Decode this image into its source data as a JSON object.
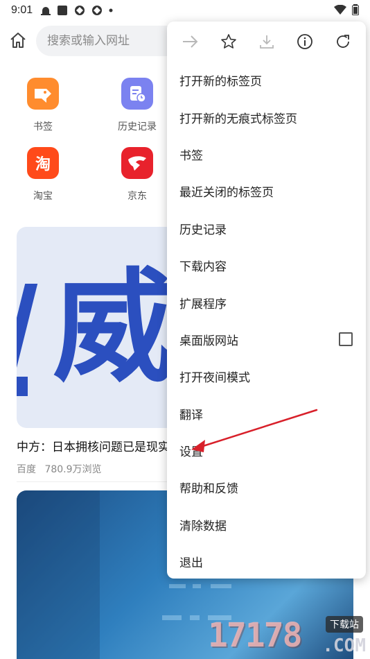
{
  "status_bar": {
    "time": "9:01",
    "icons": [
      "notification-icon",
      "square-icon",
      "network-icon",
      "network-icon",
      "dot-icon"
    ],
    "right_icons": [
      "wifi-icon",
      "battery-icon"
    ]
  },
  "search": {
    "placeholder": "搜索或输入网址"
  },
  "shortcuts": [
    {
      "label": "书签",
      "color": "#ff8c2e"
    },
    {
      "label": "历史记录",
      "color": "#7b82f0"
    },
    {
      "label": "淘宝",
      "color": "#ff4a1a",
      "icon_text": "淘"
    },
    {
      "label": "京东",
      "color": "#e8222c"
    }
  ],
  "news": {
    "image_text": "威",
    "title": "中方：日本拥核问题已是现实",
    "source": "百度",
    "views": "780.9万浏览"
  },
  "menu": {
    "icons": [
      "forward-icon",
      "star-icon",
      "download-icon",
      "info-icon",
      "refresh-icon"
    ],
    "items": [
      {
        "label": "打开新的标签页"
      },
      {
        "label": "打开新的无痕式标签页"
      },
      {
        "label": "书签"
      },
      {
        "label": "最近关闭的标签页"
      },
      {
        "label": "历史记录"
      },
      {
        "label": "下载内容"
      },
      {
        "label": "扩展程序"
      },
      {
        "label": "桌面版网站",
        "checkbox": false
      },
      {
        "label": "打开夜间模式"
      },
      {
        "label": "翻译"
      },
      {
        "label": "设置"
      },
      {
        "label": "帮助和反馈"
      },
      {
        "label": "清除数据"
      },
      {
        "label": "退出"
      }
    ]
  },
  "watermark": {
    "digits": "17178",
    "domain": ".COM",
    "badge": "下载站"
  },
  "colors": {
    "accent_arrow": "#d8202a",
    "news_brand_blue": "#2b4fbf"
  }
}
